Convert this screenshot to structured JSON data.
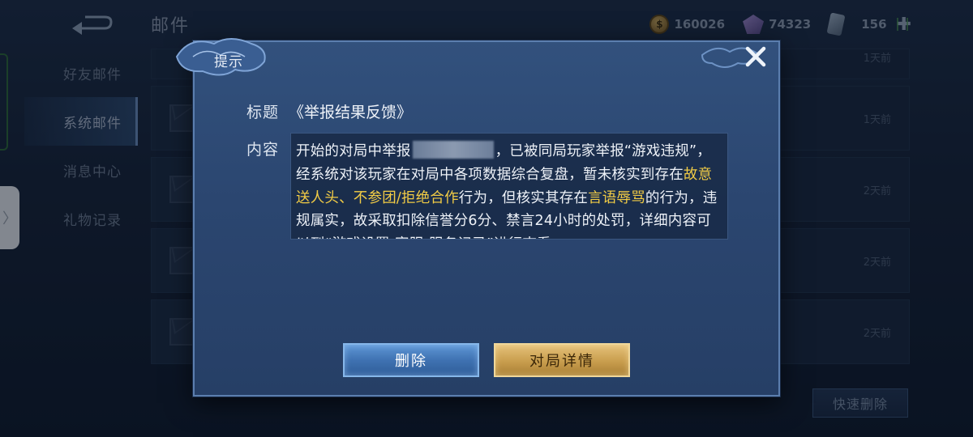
{
  "screen": {
    "title": "邮件",
    "back_icon": "back-arrow-icon"
  },
  "resources": {
    "coins": "160026",
    "gems": "74323",
    "cards": "156"
  },
  "sidebar": {
    "items": [
      {
        "label": "好友邮件",
        "active": false
      },
      {
        "label": "系统邮件",
        "active": true
      },
      {
        "label": "消息中心",
        "active": false
      },
      {
        "label": "礼物记录",
        "active": false
      }
    ]
  },
  "mail_list": {
    "times": [
      "1天前",
      "1天前",
      "2天前",
      "2天前",
      "2天前"
    ]
  },
  "quick_delete_label": "快速删除",
  "dialog": {
    "title": "提示",
    "subject_label": "标题",
    "subject_value": "《举报结果反馈》",
    "content_label": "内容",
    "content": {
      "p1": "开始的对局中举报",
      "p2": "，已被同局玩家举报“游戏违规”，经系统对该玩家在对局中各项数据综合复盘，暂未核实到存在",
      "h1": "故意送人头、不参团/拒绝合作",
      "p3": "行为，但核实其存在",
      "h2": "言语辱骂",
      "p4": "的行为，违规属实，故采取扣除信誉分6分、禁言24小时的处罚，详细内容可以到“游戏设置-客服-服务记录”进行查看"
    },
    "delete_label": "删除",
    "detail_label": "对局详情"
  },
  "colors": {
    "highlight": "#f2cc45",
    "dialog_bg": "#2b4670",
    "delete_button": "#3f72b2",
    "detail_button": "#c89d4d"
  }
}
